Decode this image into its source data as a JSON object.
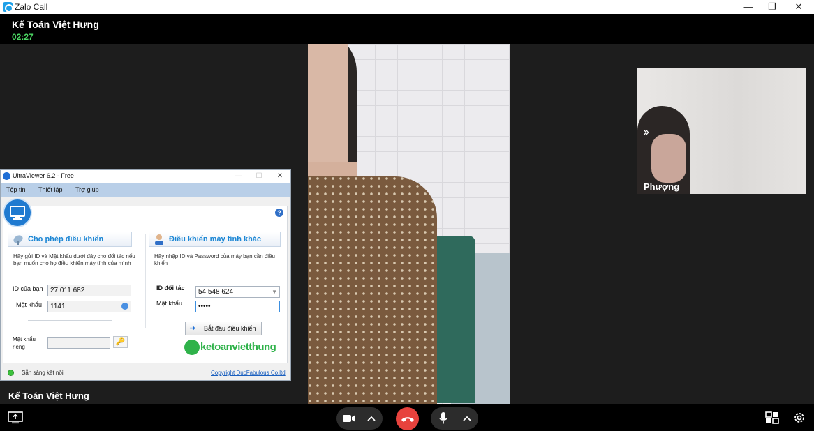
{
  "window": {
    "app_title": "Zalo Call",
    "minimize": "—",
    "restore": "❐",
    "close": "✕"
  },
  "call": {
    "contact_name": "Kế Toán Việt Hưng",
    "duration": "02:27",
    "caller_label": "Kế Toán Việt Hưng",
    "thumbnail_name": "Phượng",
    "thumbnail_expand": "››"
  },
  "controls": {
    "end_call_color": "#e7423d",
    "icons": [
      "screen-share-icon",
      "camera-icon",
      "chevron-up-icon",
      "phone-hangup-icon",
      "microphone-icon",
      "chevron-up-icon",
      "layout-grid-icon",
      "settings-gear-icon"
    ]
  },
  "ultraviewer": {
    "title": "UltraViewer 6.2 - Free",
    "title_buttons": {
      "minimize": "—",
      "maximize": "☐",
      "close": "✕"
    },
    "menu": [
      "Tệp tin",
      "Thiết lập",
      "Trợ giúp"
    ],
    "help": "?",
    "allow_section": {
      "title": "Cho phép điều khiển",
      "description": "Hãy gửi ID và Mật khẩu dưới đây cho đối tác nếu bạn muốn cho họ điều khiển máy tính của mình",
      "id_label": "ID của bạn",
      "id_value": "27 011 682",
      "password_label": "Mật khẩu",
      "password_value": "1141",
      "private_password_label": "Mật khẩu riêng",
      "private_password_value": ""
    },
    "control_section": {
      "title": "Điều khiển máy tính khác",
      "description": "Hãy nhập ID và Password của máy bạn cần điều khiển",
      "partner_id_label": "ID đối tác",
      "partner_id_value": "54 548 624",
      "password_label": "Mật khẩu",
      "password_value": "•••••",
      "start_button": "Bắt đầu điều khiển"
    },
    "brand": "ketoanvietthung",
    "status": "Sẵn sàng kết nối",
    "copyright": "Copyright DucFabulous Co,ltd",
    "accent_color": "#1b86d4",
    "brand_color": "#2fb24a"
  }
}
